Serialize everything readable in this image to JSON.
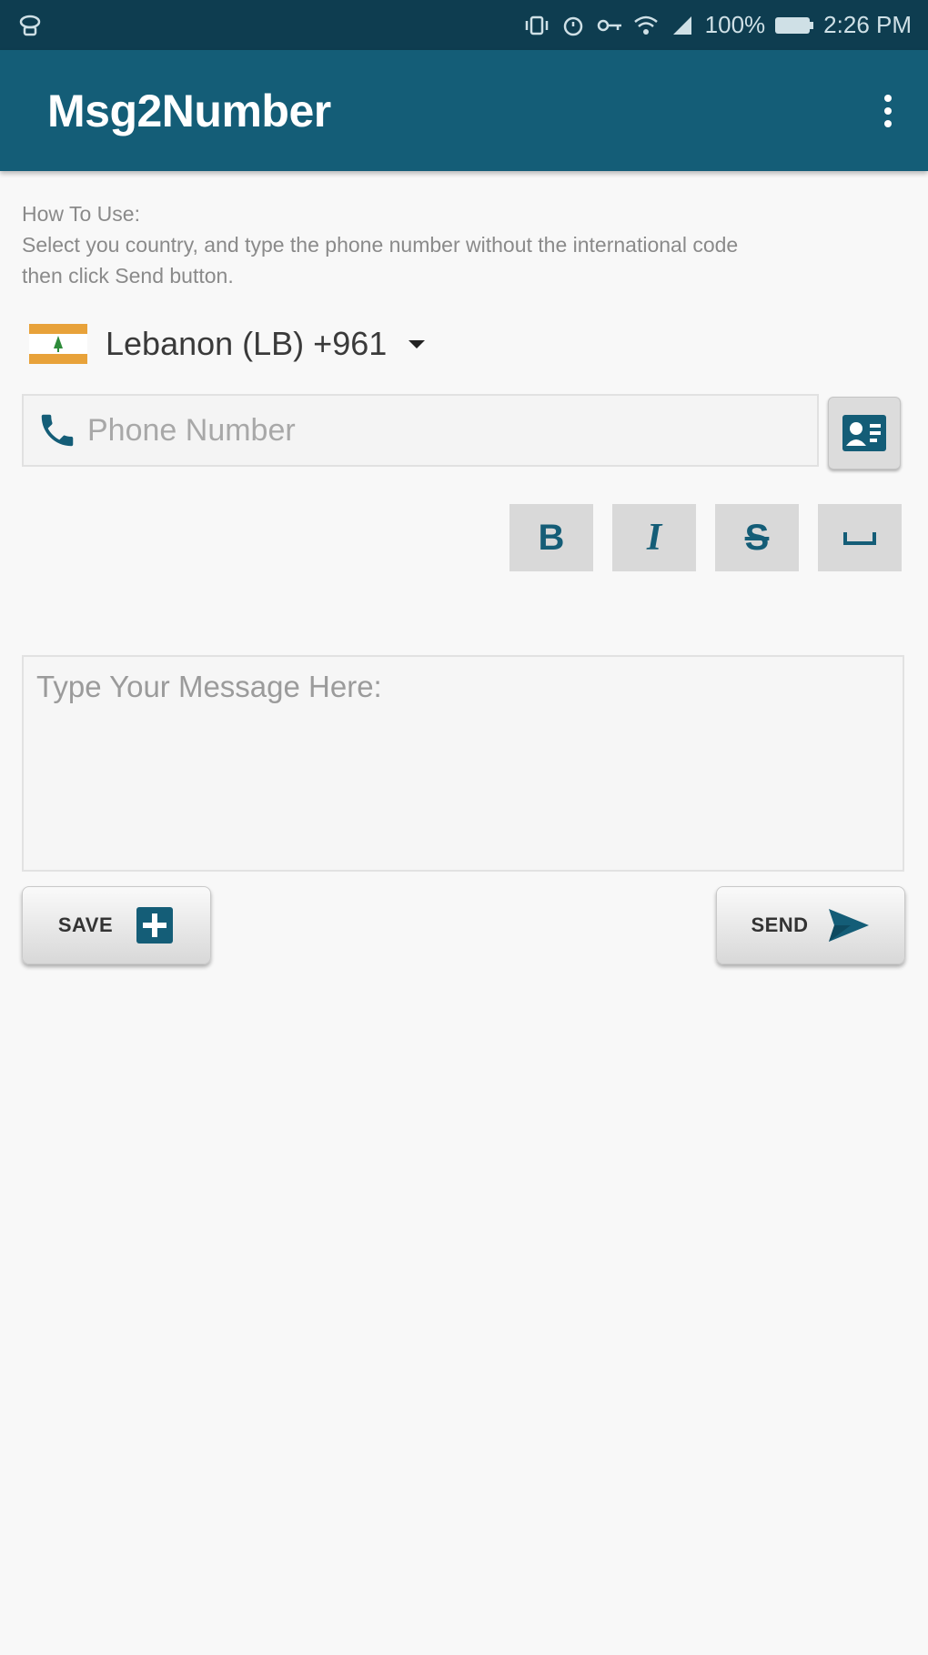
{
  "status_bar": {
    "battery": "100%",
    "time": "2:26 PM"
  },
  "app_bar": {
    "title": "Msg2Number",
    "menu_icon": "more-vert-icon"
  },
  "instructions": {
    "heading": "How To Use:",
    "line1": "Select you country, and type the phone number without the international code",
    "line2": "then click Send button."
  },
  "country_selector": {
    "flag": "lebanon-flag",
    "label": "Lebanon (LB) +961"
  },
  "phone": {
    "placeholder": "Phone Number",
    "value": ""
  },
  "format_buttons": [
    {
      "label": "B",
      "icon": "bold-icon"
    },
    {
      "label": "I",
      "icon": "italic-icon"
    },
    {
      "label": "S",
      "icon": "strikethrough-icon"
    },
    {
      "label": "",
      "icon": "monospace-icon"
    }
  ],
  "message": {
    "placeholder": "Type Your Message Here:",
    "value": ""
  },
  "actions": {
    "save_label": "SAVE",
    "send_label": "SEND"
  },
  "colors": {
    "status_bar": "#0e3d50",
    "app_bar": "#145d77",
    "accent": "#145d77",
    "background": "#f8f8f8"
  }
}
